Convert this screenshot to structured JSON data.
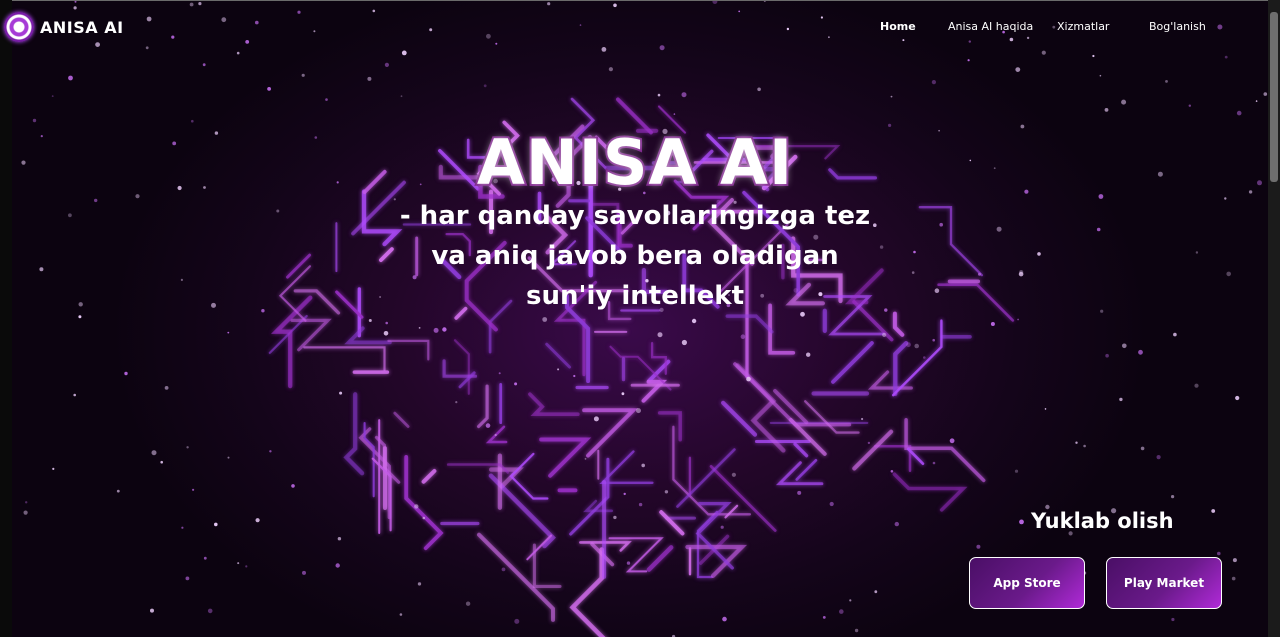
{
  "header": {
    "logo_text": "ANISA AI",
    "logo_icon": "circular-logo-icon",
    "nav": [
      {
        "label": "Home",
        "active": true
      },
      {
        "label": "Anisa AI haqida",
        "active": false
      },
      {
        "label": "Xizmatlar",
        "active": false
      },
      {
        "label": "Bog'lanish",
        "active": false
      }
    ]
  },
  "hero": {
    "title": "ANISA AI",
    "subtitle_lines": [
      "- har qanday savollaringizga tez",
      "va aniq javob bera oladigan",
      "sun'iy intellekt"
    ],
    "background": "purple circuit-board brain with glowing particles"
  },
  "download": {
    "title": "Yuklab olish",
    "buttons": [
      {
        "label": "App Store"
      },
      {
        "label": "Play Market"
      }
    ]
  },
  "colors": {
    "background": "#14051a",
    "accent": "#a63bd6",
    "title_stroke": "#7a1f88",
    "button_gradient_start": "#4a0f66",
    "button_gradient_end": "#b02ad8"
  }
}
